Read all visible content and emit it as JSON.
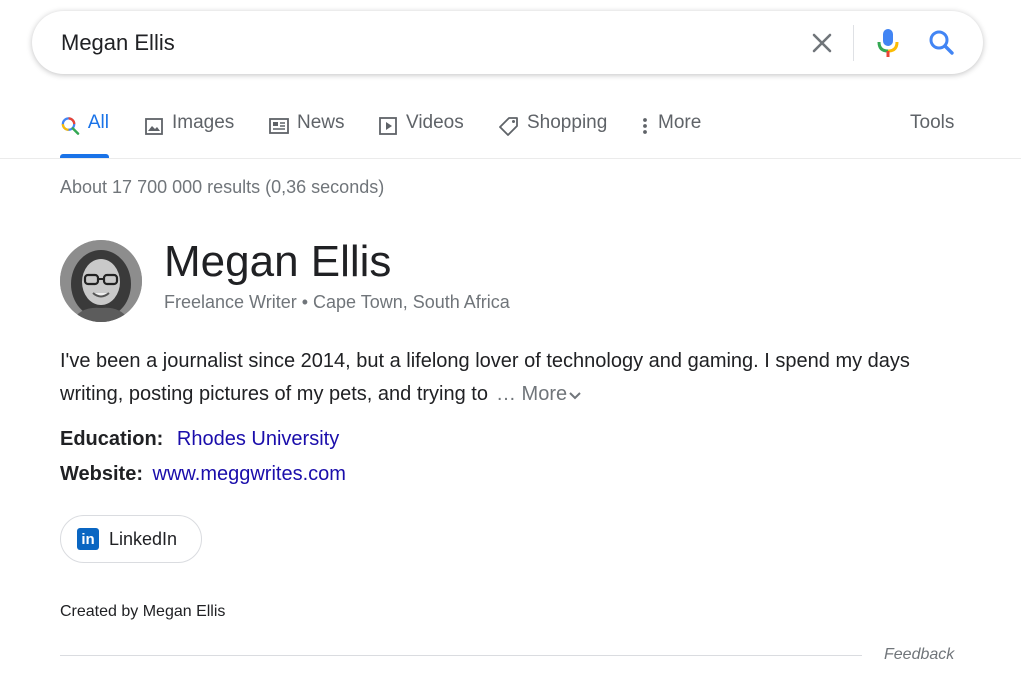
{
  "search": {
    "query": "Megan Ellis"
  },
  "tabs": [
    {
      "label": "All",
      "icon": "search-icon",
      "active": true
    },
    {
      "label": "Images",
      "icon": "image-icon"
    },
    {
      "label": "News",
      "icon": "news-icon"
    },
    {
      "label": "Videos",
      "icon": "video-icon"
    },
    {
      "label": "Shopping",
      "icon": "tag-icon"
    },
    {
      "label": "More",
      "icon": "more-vert-icon"
    }
  ],
  "tools_label": "Tools",
  "result_stats": "About 17 700 000 results (0,36 seconds)",
  "knowledge_panel": {
    "title": "Megan Ellis",
    "subtitle": "Freelance Writer • Cape Town, South Africa",
    "description": "I've been a journalist since 2014, but a lifelong lover of technology and gaming. I spend my days writing, posting pictures of my pets, and trying to",
    "more_label": "… More",
    "education_label": "Education:",
    "education_value": "Rhodes University",
    "website_label": "Website:",
    "website_value": "www.meggwrites.com",
    "social_label": "LinkedIn",
    "social_logo_text": "in",
    "created_by": "Created by Megan Ellis"
  },
  "feedback_label": "Feedback",
  "colors": {
    "accent": "#1a73e8",
    "link": "#1a0dab",
    "muted": "#70757a",
    "linkedin": "#0a66c2"
  }
}
